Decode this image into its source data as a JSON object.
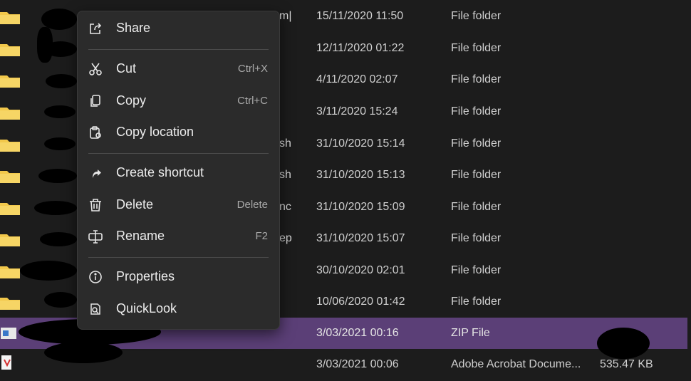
{
  "file_rows": [
    {
      "name_frag": "m|",
      "date": "15/11/2020 11:50",
      "type": "File folder"
    },
    {
      "name_frag": "",
      "date": "12/11/2020 01:22",
      "type": "File folder"
    },
    {
      "name_frag": "",
      "date": "4/11/2020 02:07",
      "type": "File folder"
    },
    {
      "name_frag": "",
      "date": "3/11/2020 15:24",
      "type": "File folder"
    },
    {
      "name_frag": "sh",
      "date": "31/10/2020 15:14",
      "type": "File folder"
    },
    {
      "name_frag": "sh",
      "date": "31/10/2020 15:13",
      "type": "File folder"
    },
    {
      "name_frag": "nc",
      "date": "31/10/2020 15:09",
      "type": "File folder"
    },
    {
      "name_frag": "ep",
      "date": "31/10/2020 15:07",
      "type": "File folder"
    },
    {
      "name_frag": "",
      "date": "30/10/2020 02:01",
      "type": "File folder"
    },
    {
      "name_frag": "",
      "date": "10/06/2020 01:42",
      "type": "File folder"
    },
    {
      "name_frag": "",
      "date": "3/03/2021 00:16",
      "type": "ZIP File",
      "size": ""
    },
    {
      "name_frag": "",
      "date": "3/03/2021 00:06",
      "type": "Adobe Acrobat Docume...",
      "size": "535.47 KB"
    }
  ],
  "context_menu": {
    "share": {
      "label": "Share",
      "icon": "share-icon"
    },
    "cut": {
      "label": "Cut",
      "shortcut": "Ctrl+X",
      "icon": "scissors-icon"
    },
    "copy": {
      "label": "Copy",
      "shortcut": "Ctrl+C",
      "icon": "copy-icon"
    },
    "copy_location": {
      "label": "Copy location",
      "icon": "clipboard-icon"
    },
    "create_shortcut": {
      "label": "Create shortcut",
      "icon": "shortcut-arrow-icon"
    },
    "delete": {
      "label": "Delete",
      "shortcut": "Delete",
      "icon": "trash-icon"
    },
    "rename": {
      "label": "Rename",
      "shortcut": "F2",
      "icon": "rename-icon"
    },
    "properties": {
      "label": "Properties",
      "icon": "info-icon"
    },
    "quicklook": {
      "label": "QuickLook",
      "icon": "quicklook-icon"
    }
  },
  "colors": {
    "background": "#1c1c1c",
    "selected_row": "#5b3f77",
    "menu_bg": "#2b2b2b",
    "folder": "#f2c84b"
  }
}
